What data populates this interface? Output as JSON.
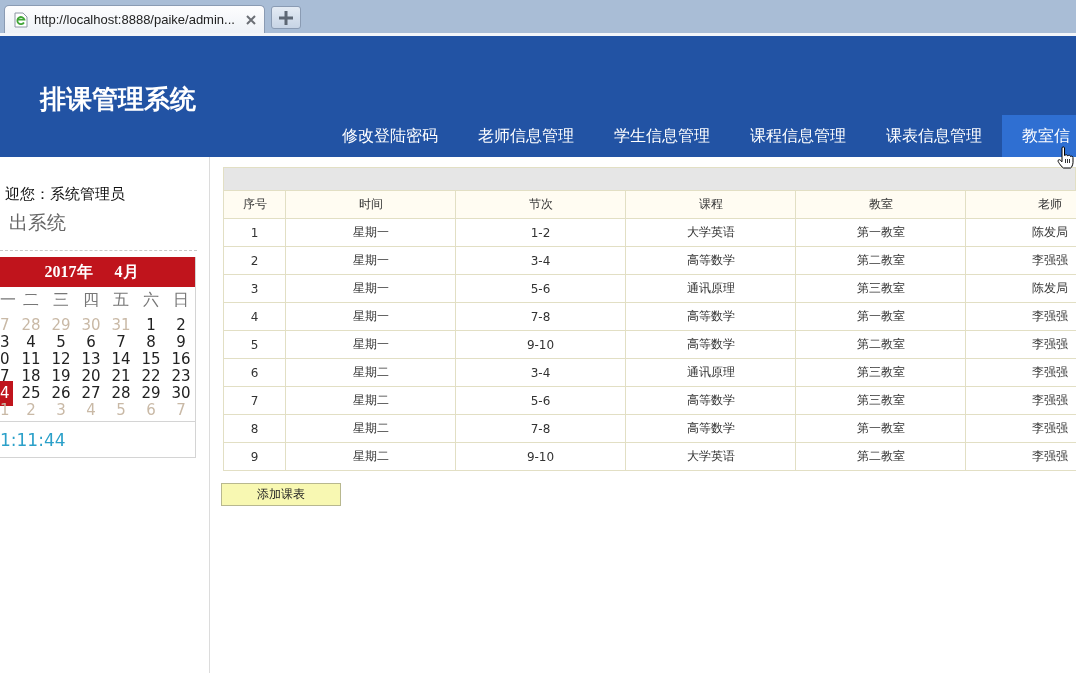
{
  "browser": {
    "tab_title": "http://localhost:8888/paike/admin..."
  },
  "header": {
    "title": "排课管理系统",
    "nav": [
      {
        "label": "修改登陆密码",
        "selected": false
      },
      {
        "label": "老师信息管理",
        "selected": false
      },
      {
        "label": "学生信息管理",
        "selected": false
      },
      {
        "label": "课程信息管理",
        "selected": false
      },
      {
        "label": "课表信息管理",
        "selected": false
      },
      {
        "label": "教室信",
        "selected": true
      }
    ]
  },
  "sidebar": {
    "welcome": "迎您：系统管理员",
    "logout": "出系统",
    "calendar": {
      "year": "2017年",
      "month": "4月",
      "weekdays": [
        "一",
        "二",
        "三",
        "四",
        "五",
        "六",
        "日"
      ],
      "days": [
        {
          "label": "7",
          "kind": "other",
          "selected": false
        },
        {
          "label": "28",
          "kind": "other",
          "selected": false
        },
        {
          "label": "29",
          "kind": "other",
          "selected": false
        },
        {
          "label": "30",
          "kind": "other",
          "selected": false
        },
        {
          "label": "31",
          "kind": "other",
          "selected": false
        },
        {
          "label": "1",
          "kind": "current",
          "selected": false
        },
        {
          "label": "2",
          "kind": "current",
          "selected": false
        },
        {
          "label": "3",
          "kind": "current",
          "selected": false
        },
        {
          "label": "4",
          "kind": "current",
          "selected": false
        },
        {
          "label": "5",
          "kind": "current",
          "selected": false
        },
        {
          "label": "6",
          "kind": "current",
          "selected": false
        },
        {
          "label": "7",
          "kind": "current",
          "selected": false
        },
        {
          "label": "8",
          "kind": "current",
          "selected": false
        },
        {
          "label": "9",
          "kind": "current",
          "selected": false
        },
        {
          "label": "0",
          "kind": "current",
          "selected": false
        },
        {
          "label": "11",
          "kind": "current",
          "selected": false
        },
        {
          "label": "12",
          "kind": "current",
          "selected": false
        },
        {
          "label": "13",
          "kind": "current",
          "selected": false
        },
        {
          "label": "14",
          "kind": "current",
          "selected": false
        },
        {
          "label": "15",
          "kind": "current",
          "selected": false
        },
        {
          "label": "16",
          "kind": "current",
          "selected": false
        },
        {
          "label": "7",
          "kind": "current",
          "selected": false
        },
        {
          "label": "18",
          "kind": "current",
          "selected": false
        },
        {
          "label": "19",
          "kind": "current",
          "selected": false
        },
        {
          "label": "20",
          "kind": "current",
          "selected": false
        },
        {
          "label": "21",
          "kind": "current",
          "selected": false
        },
        {
          "label": "22",
          "kind": "current",
          "selected": false
        },
        {
          "label": "23",
          "kind": "current",
          "selected": false
        },
        {
          "label": "4",
          "kind": "current",
          "selected": true
        },
        {
          "label": "25",
          "kind": "current",
          "selected": false
        },
        {
          "label": "26",
          "kind": "current",
          "selected": false
        },
        {
          "label": "27",
          "kind": "current",
          "selected": false
        },
        {
          "label": "28",
          "kind": "current",
          "selected": false
        },
        {
          "label": "29",
          "kind": "current",
          "selected": false
        },
        {
          "label": "30",
          "kind": "current",
          "selected": false
        },
        {
          "label": "1",
          "kind": "other",
          "selected": false
        },
        {
          "label": "2",
          "kind": "other",
          "selected": false
        },
        {
          "label": "3",
          "kind": "other",
          "selected": false
        },
        {
          "label": "4",
          "kind": "other",
          "selected": false
        },
        {
          "label": "5",
          "kind": "other",
          "selected": false
        },
        {
          "label": "6",
          "kind": "other",
          "selected": false
        },
        {
          "label": "7",
          "kind": "other",
          "selected": false
        }
      ],
      "time": "1:11:44"
    }
  },
  "table": {
    "columns": [
      "序号",
      "时间",
      "节次",
      "课程",
      "教室",
      "老师"
    ],
    "rows": [
      [
        "1",
        "星期一",
        "1-2",
        "大学英语",
        "第一教室",
        "陈发局"
      ],
      [
        "2",
        "星期一",
        "3-4",
        "高等数学",
        "第二教室",
        "李强强"
      ],
      [
        "3",
        "星期一",
        "5-6",
        "通讯原理",
        "第三教室",
        "陈发局"
      ],
      [
        "4",
        "星期一",
        "7-8",
        "高等数学",
        "第一教室",
        "李强强"
      ],
      [
        "5",
        "星期一",
        "9-10",
        "高等数学",
        "第二教室",
        "李强强"
      ],
      [
        "6",
        "星期二",
        "3-4",
        "通讯原理",
        "第三教室",
        "李强强"
      ],
      [
        "7",
        "星期二",
        "5-6",
        "高等数学",
        "第三教室",
        "李强强"
      ],
      [
        "8",
        "星期二",
        "7-8",
        "高等数学",
        "第一教室",
        "李强强"
      ],
      [
        "9",
        "星期二",
        "9-10",
        "大学英语",
        "第二教室",
        "李强强"
      ]
    ]
  },
  "add_button": "添加课表"
}
